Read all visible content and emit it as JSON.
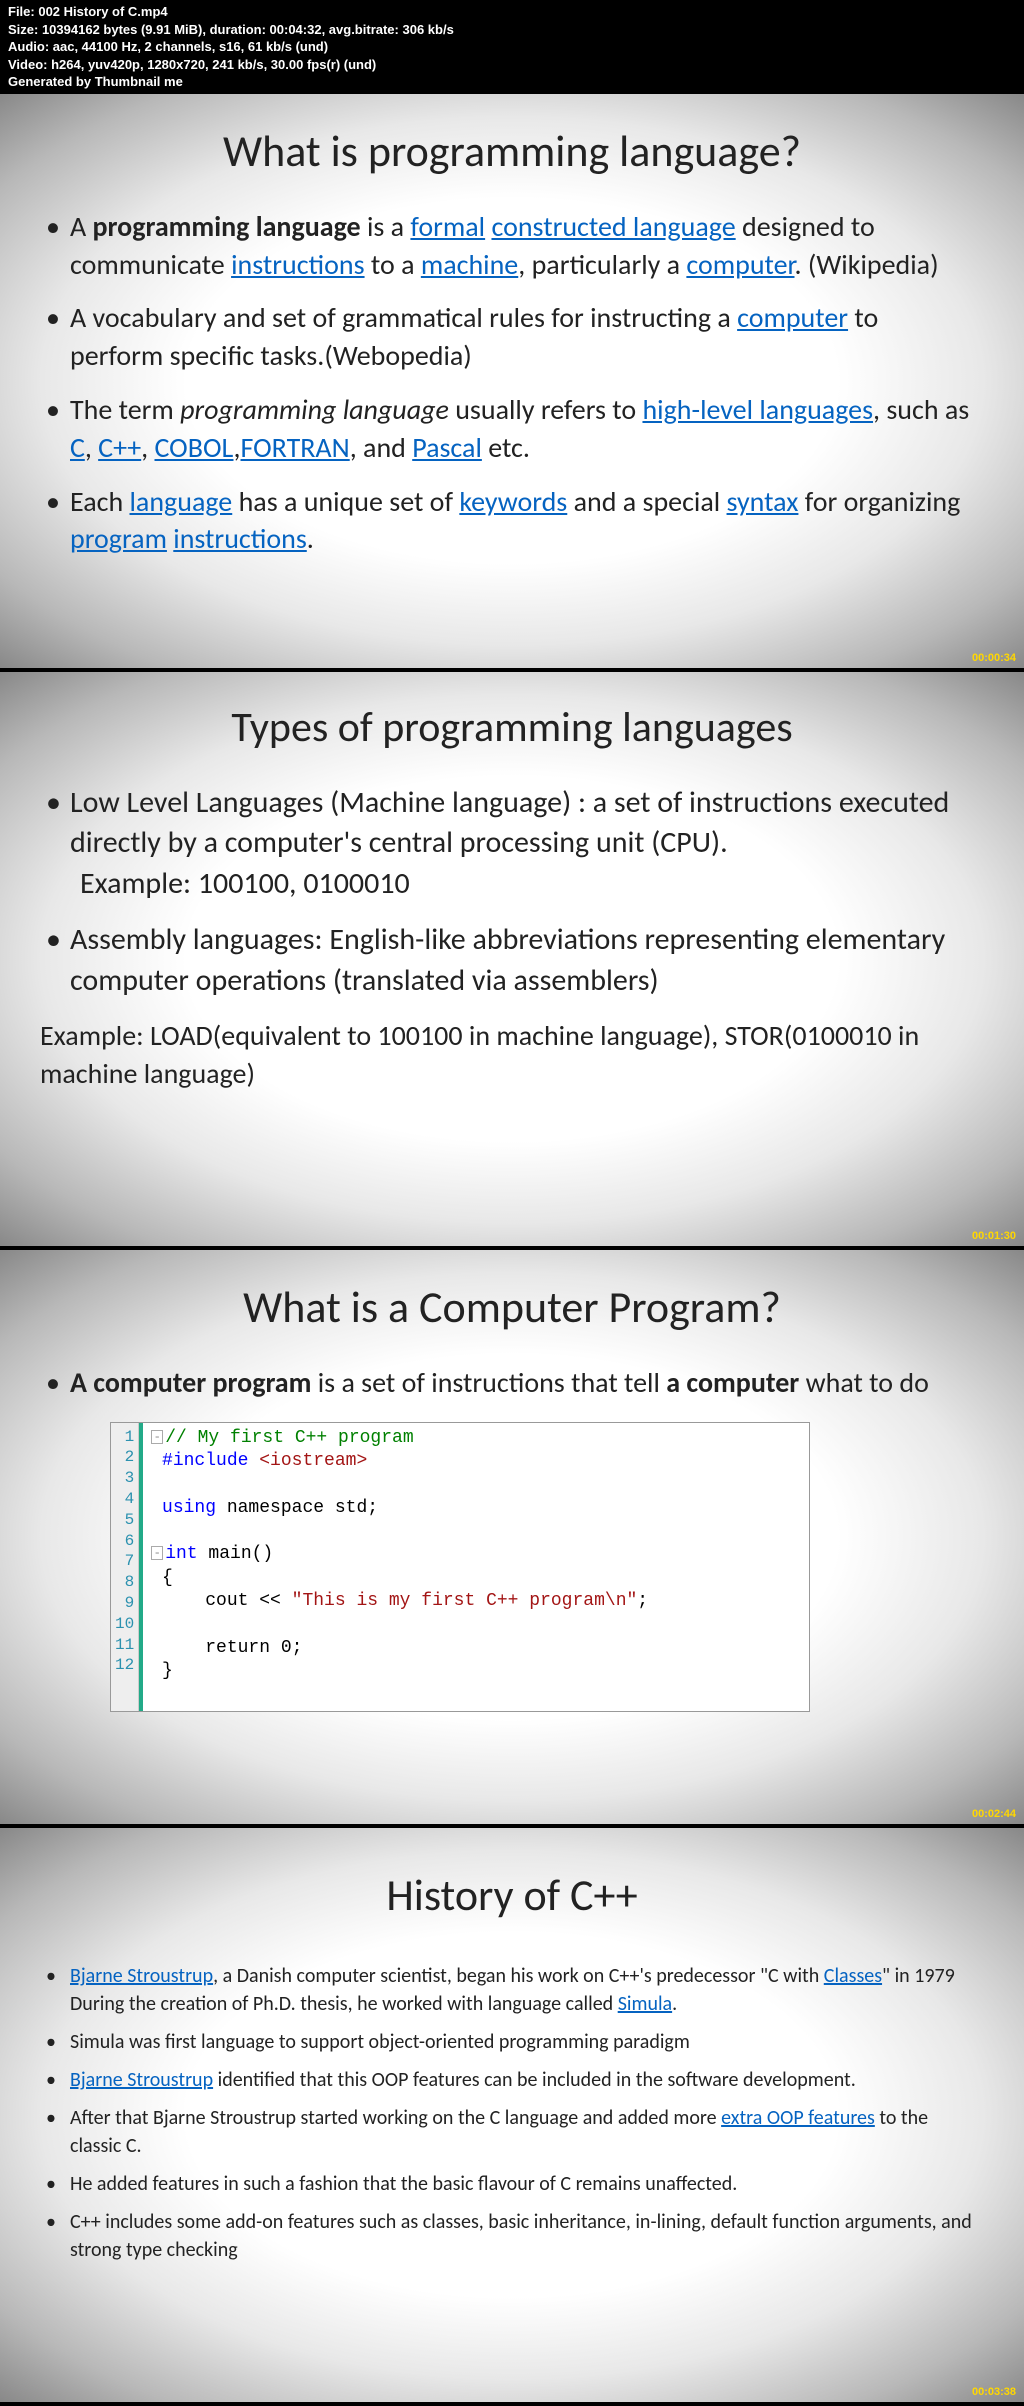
{
  "header": {
    "file": "File: 002 History of C.mp4",
    "size": "Size: 10394162 bytes (9.91 MiB), duration: 00:04:32, avg.bitrate: 306 kb/s",
    "audio": "Audio: aac, 44100 Hz, 2 channels, s16, 61 kb/s (und)",
    "video": "Video: h264, yuv420p, 1280x720, 241 kb/s, 30.00 fps(r) (und)",
    "gen": "Generated by Thumbnail me"
  },
  "s1": {
    "title": "What is programming language?",
    "ts": "00:00:34",
    "b1_pre": "A ",
    "b1_bold": "programming language",
    "b1_mid": " is a ",
    "lk_formal": "formal",
    "sp": " ",
    "lk_constructed": "constructed language",
    "b1_t2": " designed to communicate ",
    "lk_instr": "instructions",
    "b1_t3": " to a ",
    "lk_machine": "machine",
    "b1_t4": ", particularly a ",
    "lk_computer": "computer",
    "b1_t5": ". (Wikipedia)",
    "b2_t1": "A vocabulary and set of grammatical rules for instructing a ",
    "b2_t2": " to perform specific tasks.(Webopedia)",
    "b3_t1": "The term ",
    "b3_ital": "programming language",
    "b3_t2": " usually refers to ",
    "lk_hl": "high-level languages",
    "b3_t3": ", such as ",
    "lk_c": "C",
    "cm": ", ",
    "lk_cpp": "C++",
    "lk_cobol": "COBOL",
    "lk_fortran": "FORTRAN",
    "b3_t4": ", and ",
    "lk_pascal": "Pascal",
    "b3_t5": " etc.",
    "b4_t1": " Each ",
    "lk_lang": "language",
    "b4_t2": " has a unique set of ",
    "lk_kw": "keywords",
    "b4_t3": " and a special ",
    "lk_syntax": "syntax",
    "b4_t4": " for organizing ",
    "lk_prog": "program",
    "lk_instr2": "instructions",
    "dot": "."
  },
  "s2": {
    "title": "Types of programming languages",
    "ts": "00:01:30",
    "b1": "Low Level Languages (Machine language) : a set of instructions executed directly by a computer's central processing unit (CPU).",
    "b1ex": "Example: 100100, 0100010",
    "b2": "Assembly languages: English-like abbreviations representing elementary computer operations (translated via assemblers)",
    "extra": "Example: LOAD(equivalent to 100100 in machine language), STOR(0100010 in machine language)"
  },
  "s3": {
    "title": "What is a Computer Program?",
    "ts": "00:02:44",
    "b1_bold1": "A computer program",
    "b1_t1": " is a set of instructions that tell ",
    "b1_bold2": "a computer",
    "b1_t2": " what to do",
    "code": {
      "l1": "// My first C++ program",
      "l2a": "#include ",
      "l2b": "<iostream>",
      "l4a": "using",
      "l4b": " namespace std;",
      "l6a": "int",
      "l6b": " main()",
      "l7": "{",
      "l8a": "    cout << ",
      "l8b": "\"This is my first C++ program\\n\"",
      "l8c": ";",
      "l10a": "    return ",
      "l10b": "0",
      "l10c": ";",
      "l11": "}"
    }
  },
  "s4": {
    "title": "History of C++",
    "ts": "00:03:38",
    "lk_bjarne": "Bjarne Stroustrup",
    "b1_t1": ", a Danish computer scientist, began his work on C++'s predecessor \"C with ",
    "lk_classes": "Classes",
    "b1_t2": "\" in 1979 During the creation of Ph.D. thesis, he worked with language called ",
    "lk_simula": "Simula",
    "dot": ".",
    "b2": "Simula was first language to support object-oriented programming paradigm",
    "b3_t1": " identified that this OOP features can be included in the software development.",
    "b4_t1": "After that Bjarne Stroustrup started working on the C language and added more ",
    "lk_oop": "extra OOP features",
    "b4_t2": " to the classic C.",
    "b5": "He added features in such a fashion that the basic flavour of C remains unaffected.",
    "b6": "C++ includes some add-on features such as classes, basic inheritance, in-lining, default function arguments, and strong type checking"
  }
}
